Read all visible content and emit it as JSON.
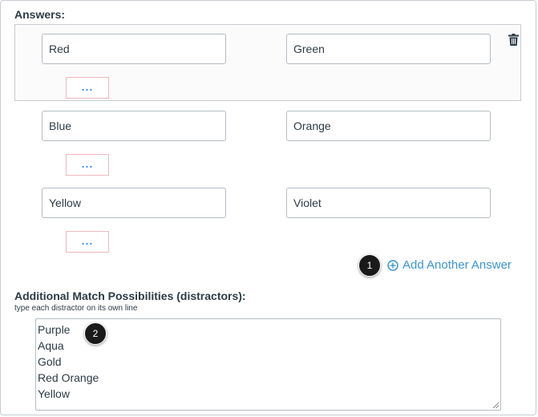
{
  "answers": {
    "label": "Answers:",
    "pairs": [
      {
        "left": "Red",
        "right": "Green",
        "more": "..."
      },
      {
        "left": "Blue",
        "right": "Orange",
        "more": "..."
      },
      {
        "left": "Yellow",
        "right": "Violet",
        "more": "..."
      }
    ],
    "add_label": "Add Another Answer"
  },
  "distractors": {
    "heading": "Additional Match Possibilities (distractors):",
    "hint": "type each distractor on its own line",
    "lines": [
      "Purple",
      "Aqua",
      "Gold",
      "Red Orange",
      "Yellow"
    ]
  },
  "callouts": [
    "1",
    "2"
  ],
  "colors": {
    "link": "#3a95d6",
    "text": "#2d3b45",
    "border": "#c7cdd1",
    "more_border": "#f2b6bf"
  },
  "icons": [
    "trash-icon",
    "plus-circle-icon"
  ]
}
